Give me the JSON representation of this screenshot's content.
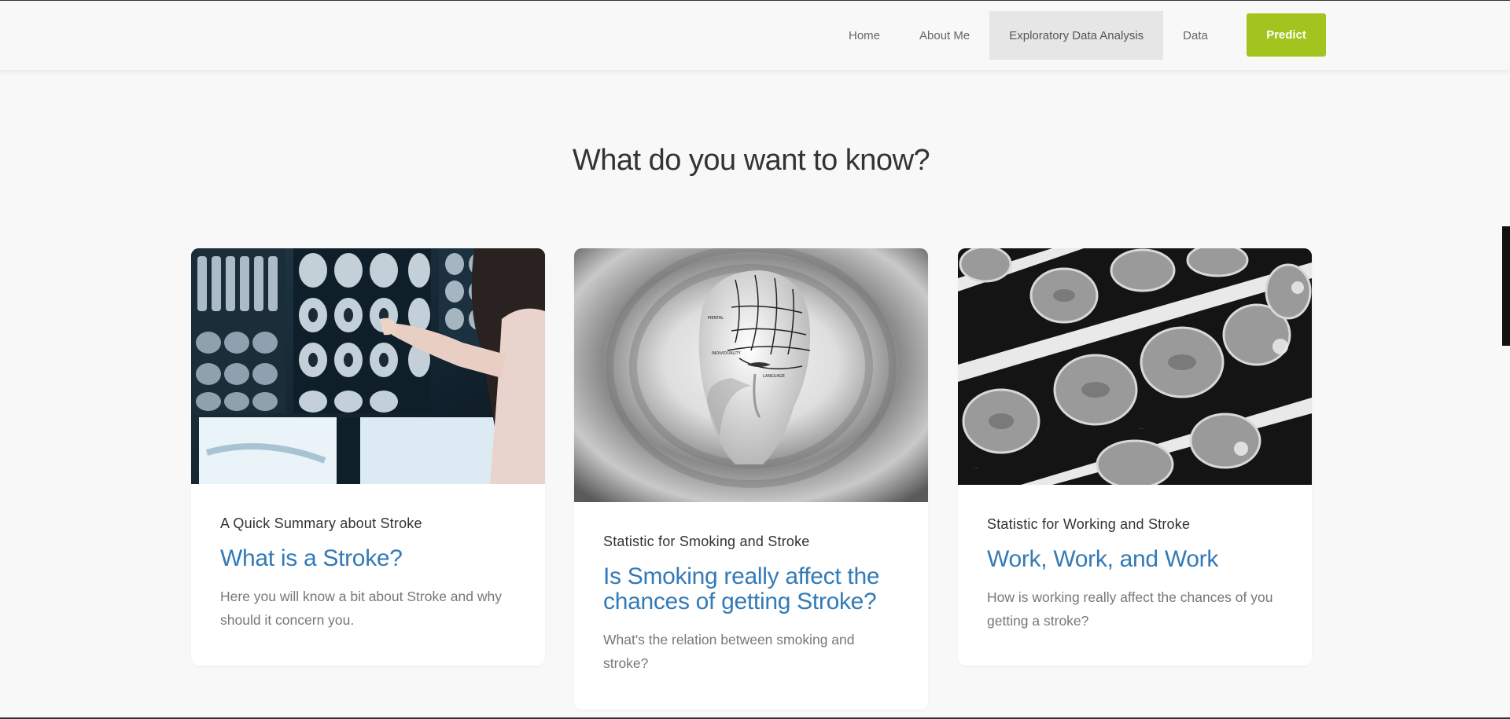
{
  "nav": {
    "items": [
      {
        "label": "Home"
      },
      {
        "label": "About Me"
      },
      {
        "label": "Exploratory Data Analysis",
        "active": true
      },
      {
        "label": "Data"
      }
    ],
    "predict_label": "Predict",
    "accent_color": "#a3c31f",
    "active_bg": "#e6e6e6"
  },
  "section": {
    "title": "What do you want to know?"
  },
  "cards": [
    {
      "subtitle": "A Quick Summary about Stroke",
      "title": "What is a Stroke?",
      "description": "Here you will know a bit about Stroke and why should it concern you.",
      "image": "doctor-examining-brain-mri-scans"
    },
    {
      "subtitle": "Statistic for Smoking and Stroke",
      "title": "Is Smoking really affect the chances of getting Stroke?",
      "description": "What's the relation between smoking and stroke?",
      "image": "phrenology-head-model"
    },
    {
      "subtitle": "Statistic for Working and Stroke",
      "title": "Work, Work, and Work",
      "description": "How is working really affect the chances of you getting a stroke?",
      "image": "brain-ct-scan-films"
    }
  ],
  "colors": {
    "link_title": "#337ab7",
    "page_bg": "#f8f8f8"
  }
}
